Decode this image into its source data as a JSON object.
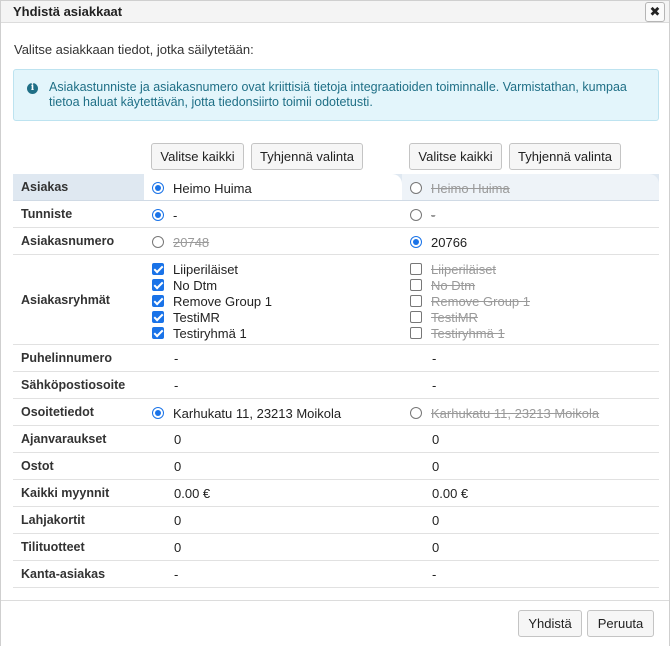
{
  "dialog": {
    "title": "Yhdistä asiakkaat",
    "close_label": "✖",
    "intro": "Valitse asiakkaan tiedot, jotka säilytetään:",
    "info": "Asiakastunniste ja asiakasnumero ovat kriittisiä tietoja integraatioiden toiminnalle. Varmistathan, kumpaa tietoa haluat käytettävän, jotta tiedonsiirto toimii odotetusti.",
    "info_icon": "i"
  },
  "column_buttons": {
    "select_all": "Valitse kaikki",
    "clear": "Tyhjennä valinta"
  },
  "rows": {
    "asiakas": {
      "label": "Asiakas",
      "a": "Heimo Huima",
      "b": "Heimo Huima"
    },
    "tunniste": {
      "label": "Tunniste",
      "a": "-",
      "b": "-"
    },
    "asiakasnumero": {
      "label": "Asiakasnumero",
      "a": "20748",
      "b": "20766"
    },
    "asiakasryhmat": {
      "label": "Asiakasryhmät",
      "groups": [
        "Liiperiläiset",
        "No Dtm",
        "Remove Group 1",
        "TestiMR",
        "Testiryhmä 1"
      ]
    },
    "puhelinnumero": {
      "label": "Puhelinnumero",
      "a": "-",
      "b": "-"
    },
    "sahkoposti": {
      "label": "Sähköpostiosoite",
      "a": "-",
      "b": "-"
    },
    "osoitetiedot": {
      "label": "Osoitetiedot",
      "a": "Karhukatu 11, 23213 Moikola",
      "b": "Karhukatu 11, 23213 Moikola"
    },
    "ajanvaraukset": {
      "label": "Ajanvaraukset",
      "a": "0",
      "b": "0"
    },
    "ostot": {
      "label": "Ostot",
      "a": "0",
      "b": "0"
    },
    "myynnit": {
      "label": "Kaikki myynnit",
      "a": "0.00 €",
      "b": "0.00 €"
    },
    "lahjakortit": {
      "label": "Lahjakortit",
      "a": "0",
      "b": "0"
    },
    "tilituotteet": {
      "label": "Tilituotteet",
      "a": "0",
      "b": "0"
    },
    "kanta": {
      "label": "Kanta-asiakas",
      "a": "-",
      "b": "-"
    }
  },
  "footer": {
    "merge": "Yhdistä",
    "cancel": "Peruuta"
  },
  "colors": {
    "accent": "#1a73e8",
    "info_bg": "#e3f5fb",
    "info_text": "#1f6f86"
  }
}
